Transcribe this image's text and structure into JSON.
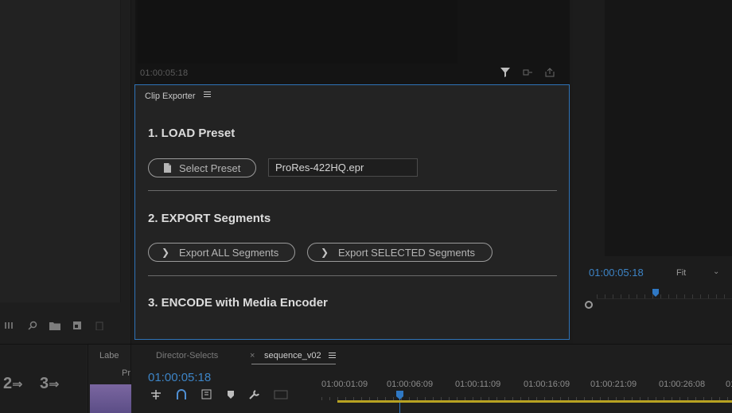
{
  "source_monitor": {
    "timecode": "01:00:05:18"
  },
  "program_monitor": {
    "timecode": "01:00:05:18",
    "zoom": "Fit"
  },
  "extension": {
    "title": "Clip Exporter",
    "sections": [
      {
        "heading": "1. LOAD Preset"
      },
      {
        "heading": "2. EXPORT Segments"
      },
      {
        "heading": "3. ENCODE with Media Encoder"
      }
    ],
    "select_preset_label": "Select Preset",
    "preset_value": "ProRes-422HQ.epr",
    "export_all_label": "Export ALL Segments",
    "export_selected_label": "Export SELECTED Segments"
  },
  "tools": {
    "num2": "2",
    "num3": "3"
  },
  "project": {
    "label": "Labe",
    "pr": "Pr"
  },
  "timeline": {
    "tab1": "Director-Selects",
    "close": "×",
    "tab2": "sequence_v02",
    "timecode": "01:00:05:18",
    "ruler_labels": [
      "01:00:01:09",
      "01:00:06:09",
      "01:00:11:09",
      "01:00:16:09",
      "01:00:21:09",
      "01:00:26:08",
      "01:0"
    ]
  },
  "colors": {
    "accent": "#3d84c6",
    "panel_border": "#2f73b7",
    "work_area": "#b8a322"
  },
  "icons": {
    "source": [
      "filter-icon",
      "insert-icon",
      "export-frame-icon"
    ],
    "left_toolbar": [
      "list-view-icon",
      "search-icon",
      "folder-icon",
      "new-item-icon",
      "trash-icon"
    ],
    "timeline": [
      "snap-icon",
      "link-icon",
      "marker-add-icon",
      "marker-icon",
      "wrench-icon",
      "captions-icon"
    ]
  }
}
